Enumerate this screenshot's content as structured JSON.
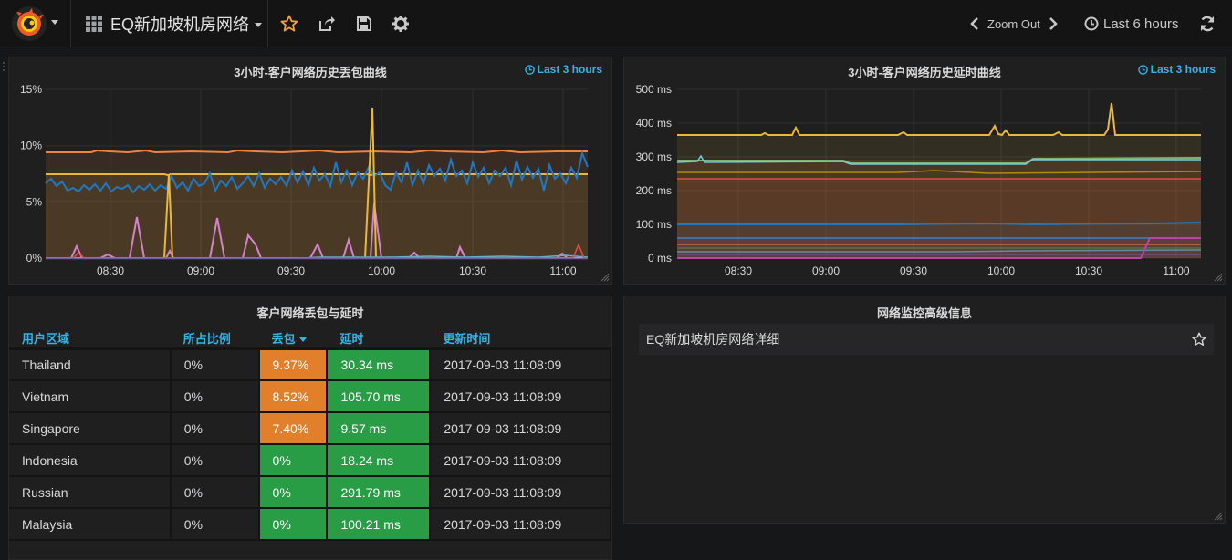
{
  "topbar": {
    "dashboard_title": "EQ新加坡机房网络",
    "zoom_out_label": "Zoom Out",
    "time_range_label": "Last 6 hours",
    "icons": [
      "grafana-logo-icon",
      "dashboard-grid-icon",
      "star-icon",
      "share-icon",
      "save-icon",
      "gear-icon",
      "chevron-left-icon",
      "chevron-right-icon",
      "clock-icon",
      "refresh-icon"
    ],
    "accent_color": "#f2a03b"
  },
  "panels": {
    "loss_chart": {
      "title": "3小时-客户网络历史丢包曲线",
      "time_info": "Last 3 hours"
    },
    "latency_chart": {
      "title": "3小时-客户网络历史延时曲线",
      "time_info": "Last 3 hours"
    },
    "table": {
      "title": "客户网络丢包与延时",
      "headers": [
        "用户区域",
        "所占比例",
        "丢包",
        "延时",
        "更新时间"
      ],
      "rows": [
        {
          "region": "Thailand",
          "ratio": "0%",
          "loss": "9.37%",
          "latency": "30.34 ms",
          "updated": "2017-09-03 11:08:09",
          "loss_status": "warning"
        },
        {
          "region": "Vietnam",
          "ratio": "0%",
          "loss": "8.52%",
          "latency": "105.70 ms",
          "updated": "2017-09-03 11:08:09",
          "loss_status": "warning"
        },
        {
          "region": "Singapore",
          "ratio": "0%",
          "loss": "7.40%",
          "latency": "9.57 ms",
          "updated": "2017-09-03 11:08:09",
          "loss_status": "warning"
        },
        {
          "region": "Indonesia",
          "ratio": "0%",
          "loss": "0%",
          "latency": "18.24 ms",
          "updated": "2017-09-03 11:08:09",
          "loss_status": "ok"
        },
        {
          "region": "Russian",
          "ratio": "0%",
          "loss": "0%",
          "latency": "291.79 ms",
          "updated": "2017-09-03 11:08:09",
          "loss_status": "ok"
        },
        {
          "region": "Malaysia",
          "ratio": "0%",
          "loss": "0%",
          "latency": "100.21 ms",
          "updated": "2017-09-03 11:08:09",
          "loss_status": "ok"
        }
      ],
      "status_colors": {
        "warning": "#e17f2a",
        "ok": "#299c46"
      }
    },
    "dashlist": {
      "title": "网络监控高级信息",
      "items": [
        {
          "label": "EQ新加坡机房网络详细"
        }
      ]
    }
  },
  "chart_data": [
    {
      "type": "line",
      "title": "3小时-客户网络历史丢包曲线",
      "y_ticks": [
        "0%",
        "5%",
        "10%",
        "15%"
      ],
      "ylim": [
        0,
        15
      ],
      "x_ticks": [
        "08:30",
        "09:00",
        "09:30",
        "10:00",
        "10:30",
        "11:00"
      ],
      "xlim_minutes": [
        "08:10",
        "11:08"
      ],
      "grid": true,
      "series": [
        {
          "color": "#ef843c",
          "fill": true,
          "values_approx": [
            9.4,
            9.5,
            9.4,
            9.5,
            9.4,
            9.5,
            9.4,
            9.4,
            9.5,
            9.4,
            9.5,
            9.4,
            9.4
          ]
        },
        {
          "color": "#eab839",
          "fill": true,
          "values_approx": [
            7.4,
            7.4,
            7.4,
            7.4,
            7.4,
            7.4,
            7.4,
            7.4,
            7.4,
            7.4,
            7.4,
            7.4,
            7.4
          ]
        },
        {
          "color": "#1f78c1",
          "fill": false,
          "values_approx": [
            6.2,
            6.5,
            6.0,
            6.4,
            5.8,
            6.3,
            7.2,
            8.0,
            7.5,
            8.2,
            7.9,
            8.4,
            8.8,
            8.1
          ]
        },
        {
          "color": "#d683ce",
          "fill": false,
          "values_approx": [
            0,
            0.5,
            0,
            3.5,
            0,
            3.5,
            0,
            1.5,
            0,
            0,
            1,
            0,
            0,
            0
          ]
        },
        {
          "color": "#eab839",
          "fill": false,
          "spikes": [
            {
              "x": "08:48",
              "y": 7.4
            },
            {
              "x": "09:57",
              "y": 13.2
            }
          ]
        },
        {
          "color": "#64b0c8",
          "fill": false,
          "values_approx": [
            0,
            0,
            0,
            0,
            0,
            0.1,
            0.2,
            0.2,
            0.3,
            0.2,
            0.2,
            0.3
          ]
        },
        {
          "color": "#e24d42",
          "fill": false,
          "values_approx": [
            0,
            0,
            0,
            0,
            0,
            0,
            0,
            0,
            0,
            0,
            0,
            1.2
          ]
        }
      ]
    },
    {
      "type": "line",
      "title": "3小时-客户网络历史延时曲线",
      "y_ticks": [
        "0 ms",
        "100 ms",
        "200 ms",
        "300 ms",
        "400 ms",
        "500 ms"
      ],
      "ylim": [
        0,
        500
      ],
      "x_ticks": [
        "08:30",
        "09:00",
        "09:30",
        "10:00",
        "10:30",
        "11:00"
      ],
      "grid": true,
      "series": [
        {
          "color": "#eab839",
          "values_approx": [
            366,
            368,
            370,
            366,
            367,
            390,
            366,
            455,
            366,
            366
          ]
        },
        {
          "color": "#7eb26d",
          "values_approx": [
            292,
            290,
            280,
            278,
            280,
            293,
            295,
            294,
            295
          ]
        },
        {
          "color": "#6ed0e0",
          "values_approx": [
            287,
            286,
            285,
            284,
            286,
            287,
            288
          ]
        },
        {
          "color": "#cca300",
          "values_approx": [
            255,
            254,
            254,
            255,
            255
          ]
        },
        {
          "color": "#e24d42",
          "values_approx": [
            236,
            235,
            235,
            234,
            235
          ]
        },
        {
          "color": "#bf1b00",
          "values_approx": [
            228,
            228,
            228,
            228,
            228
          ]
        },
        {
          "color": "#1f78c1",
          "values_approx": [
            100,
            100,
            101,
            100,
            102,
            104
          ]
        },
        {
          "color": "#447ebc",
          "values_approx": [
            60,
            60,
            60,
            60,
            60
          ]
        },
        {
          "color": "#ba43a9",
          "values_approx": [
            0,
            0,
            0,
            0,
            0,
            58
          ]
        },
        {
          "color": "#ef843c",
          "values_approx": [
            40,
            40,
            40,
            40
          ]
        },
        {
          "color": "#508642",
          "values_approx": [
            30,
            30,
            30,
            30
          ]
        },
        {
          "color": "#64b0c8",
          "values_approx": [
            18,
            18,
            18,
            18
          ]
        },
        {
          "color": "#705da0",
          "values_approx": [
            10,
            10,
            10,
            10
          ]
        }
      ]
    }
  ]
}
